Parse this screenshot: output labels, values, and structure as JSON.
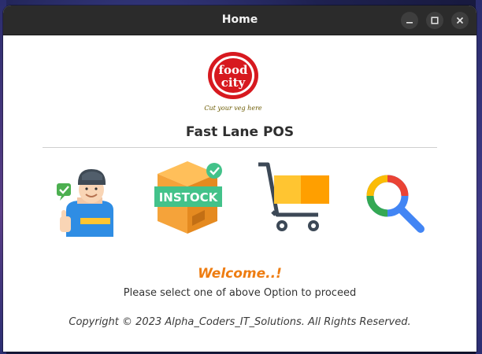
{
  "window": {
    "title": "Home"
  },
  "logo": {
    "brand_line1": "food",
    "brand_line2": "city",
    "tagline": "Cut your veg here"
  },
  "app": {
    "title": "Fast Lane POS"
  },
  "options": [
    {
      "name": "user-option",
      "icon": "cashier-user-icon"
    },
    {
      "name": "instock-option",
      "icon": "instock-box-icon",
      "badge_text": "INSTOCK"
    },
    {
      "name": "cart-option",
      "icon": "shopping-cart-icon"
    },
    {
      "name": "search-option",
      "icon": "search-icon"
    }
  ],
  "messages": {
    "welcome": "Welcome..!",
    "instruction": "Please select one of above Option to proceed",
    "copyright": "Copyright © 2023 Alpha_Coders_IT_Solutions. All Rights Reserved."
  },
  "colors": {
    "accent": "#ee7d12",
    "titlebar": "#2b2b2b",
    "brand_red": "#d7191f"
  }
}
